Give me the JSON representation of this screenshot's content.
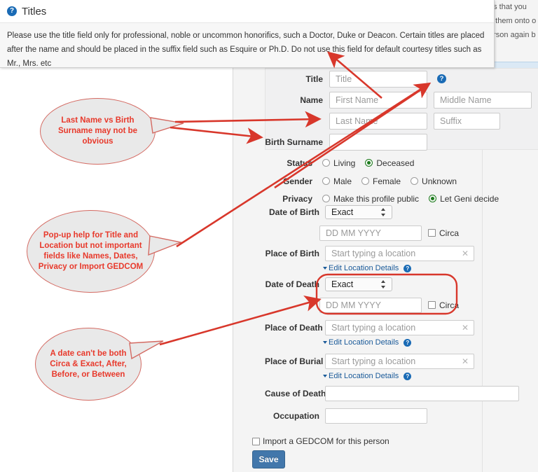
{
  "tooltip": {
    "icon": "help-circle-icon",
    "title": "Titles",
    "body": "Please use the title field only for professional, noble or uncommon honorifics, such a Doctor, Duke or Deacon. Certain titles are placed after the name and should be placed in the suffix field such as Esquire or Ph.D. Do not use this field for default courtesy titles such as Mr., Mrs. etc"
  },
  "background_text": {
    "line1": "ns that you",
    "line2": "d them onto o",
    "line3": "erson again b"
  },
  "form": {
    "title_label": "Title",
    "title_placeholder": "Title",
    "name_label": "Name",
    "first_name_placeholder": "First Name",
    "middle_name_placeholder": "Middle Name",
    "last_name_placeholder": "Last Name",
    "suffix_placeholder": "Suffix",
    "birth_surname_label": "Birth Surname",
    "birth_surname_value": "",
    "status_label": "Status",
    "status_options": [
      "Living",
      "Deceased"
    ],
    "status_selected": "Deceased",
    "gender_label": "Gender",
    "gender_options": [
      "Male",
      "Female",
      "Unknown"
    ],
    "gender_selected": "",
    "privacy_label": "Privacy",
    "privacy_options": [
      "Make this profile public",
      "Let Geni decide"
    ],
    "privacy_selected": "Let Geni decide",
    "date_of_birth_label": "Date of Birth",
    "date_of_birth_type": "Exact",
    "date_placeholder": "DD MM YYYY",
    "circa_label": "Circa",
    "place_of_birth_label": "Place of Birth",
    "location_placeholder": "Start typing a location",
    "edit_location_label": "Edit Location Details",
    "date_of_death_label": "Date of Death",
    "date_of_death_type": "Exact",
    "place_of_death_label": "Place of Death",
    "place_of_burial_label": "Place of Burial",
    "cause_of_death_label": "Cause of Death",
    "cause_of_death_value": "",
    "occupation_label": "Occupation",
    "occupation_value": "",
    "import_gedcom_label": "Import a GEDCOM for this person",
    "save_label": "Save"
  },
  "annotations": {
    "callout1": "Last Name vs Birth Surname may not be obvious",
    "callout2": "Pop-up help for Title and Location but not important fields like Names, Dates, Privacy or Import GEDCOM",
    "callout3": "A date can't be both Circa & Exact, After, Before, or Between",
    "color": "#e8392b"
  }
}
